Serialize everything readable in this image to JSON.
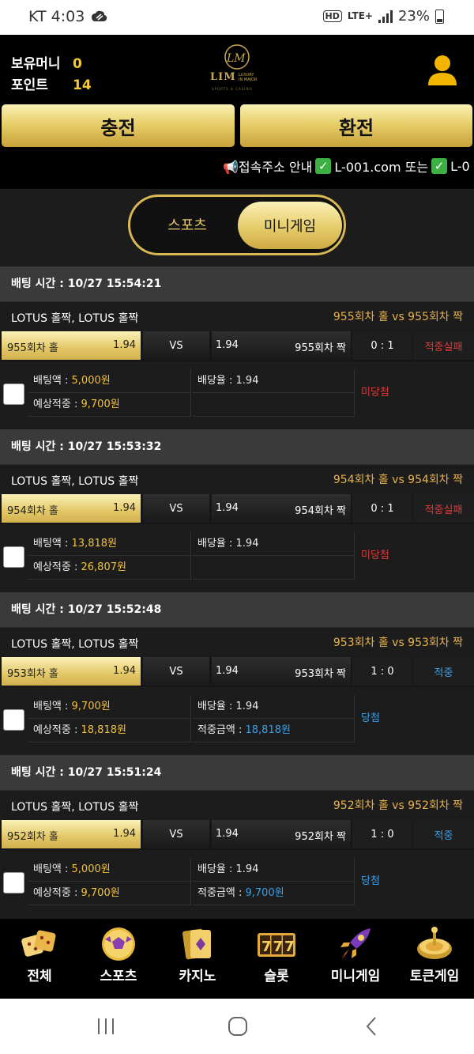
{
  "statusbar": {
    "carrier_time": "KT 4:03",
    "hd": "HD",
    "lte": "LTE+",
    "battery": "23%"
  },
  "header": {
    "balance_label": "보유머니",
    "balance_value": "0",
    "points_label": "포인트",
    "points_value": "14",
    "logo_text": "LIM",
    "logo_tagline_1": "LUXURY",
    "logo_tagline_2": "IN MAJOR",
    "logo_sub": "SPORTS & CASINO",
    "charge_label": "충전",
    "exchange_label": "환전",
    "marquee_1": "📢접속주소 안내",
    "marquee_2": "L-001.com 또는",
    "marquee_3": "L-0"
  },
  "toggle": {
    "sports": "스포츠",
    "minigame": "미니게임",
    "active": "미니게임"
  },
  "bets": [
    {
      "time": "배팅 시간 : 10/27 15:54:21",
      "game": "LOTUS 홀짝, LOTUS 홀짝",
      "matchup": "955회차 홀  vs  955회차 짝",
      "home": "955회차 홀",
      "home_odds": "1.94",
      "vs": "VS",
      "away_odds": "1.94",
      "away": "955회차 짝",
      "score": "0 : 1",
      "result": "적중실패",
      "result_color": "red",
      "bet_label": "배팅액 : ",
      "bet_amount": "5,000원",
      "expected_label": "예상적중 : ",
      "expected_amount": "9,700원",
      "odds_label": "배당율 : 1.94",
      "win_label": "",
      "win_amount": "",
      "status": "미당첨",
      "status_color": "red"
    },
    {
      "time": "배팅 시간 : 10/27 15:53:32",
      "game": "LOTUS 홀짝, LOTUS 홀짝",
      "matchup": "954회차 홀  vs  954회차 짝",
      "home": "954회차 홀",
      "home_odds": "1.94",
      "vs": "VS",
      "away_odds": "1.94",
      "away": "954회차 짝",
      "score": "0 : 1",
      "result": "적중실패",
      "result_color": "red",
      "bet_label": "배팅액 : ",
      "bet_amount": "13,818원",
      "expected_label": "예상적중 : ",
      "expected_amount": "26,807원",
      "odds_label": "배당율 : 1.94",
      "win_label": "",
      "win_amount": "",
      "status": "미당첨",
      "status_color": "red"
    },
    {
      "time": "배팅 시간 : 10/27 15:52:48",
      "game": "LOTUS 홀짝, LOTUS 홀짝",
      "matchup": "953회차 홀  vs  953회차 짝",
      "home": "953회차 홀",
      "home_odds": "1.94",
      "vs": "VS",
      "away_odds": "1.94",
      "away": "953회차 짝",
      "score": "1 : 0",
      "result": "적중",
      "result_color": "blue",
      "bet_label": "배팅액 : ",
      "bet_amount": "9,700원",
      "expected_label": "예상적중 : ",
      "expected_amount": "18,818원",
      "odds_label": "배당율 : 1.94",
      "win_label": "적중금액 : ",
      "win_amount": "18,818원",
      "status": "당첨",
      "status_color": "blue"
    },
    {
      "time": "배팅 시간 : 10/27 15:51:24",
      "game": "LOTUS 홀짝, LOTUS 홀짝",
      "matchup": "952회차 홀  vs  952회차 짝",
      "home": "952회차 홀",
      "home_odds": "1.94",
      "vs": "VS",
      "away_odds": "1.94",
      "away": "952회차 짝",
      "score": "1 : 0",
      "result": "적중",
      "result_color": "blue",
      "bet_label": "배팅액 : ",
      "bet_amount": "5,000원",
      "expected_label": "예상적중 : ",
      "expected_amount": "9,700원",
      "odds_label": "배당율 : 1.94",
      "win_label": "적중금액 : ",
      "win_amount": "9,700원",
      "status": "당첨",
      "status_color": "blue"
    }
  ],
  "bottom_nav": [
    {
      "label": "전체",
      "icon": "dice-icon"
    },
    {
      "label": "스포츠",
      "icon": "soccer-ball-icon"
    },
    {
      "label": "카지노",
      "icon": "playing-cards-icon"
    },
    {
      "label": "슬롯",
      "icon": "slot-777-icon"
    },
    {
      "label": "미니게임",
      "icon": "rocket-icon"
    },
    {
      "label": "토큰게임",
      "icon": "roulette-icon"
    }
  ],
  "colors": {
    "gold": "#f2c23c",
    "red": "#e03a3a",
    "blue": "#3aa0e8",
    "header_bg": "#000000"
  }
}
